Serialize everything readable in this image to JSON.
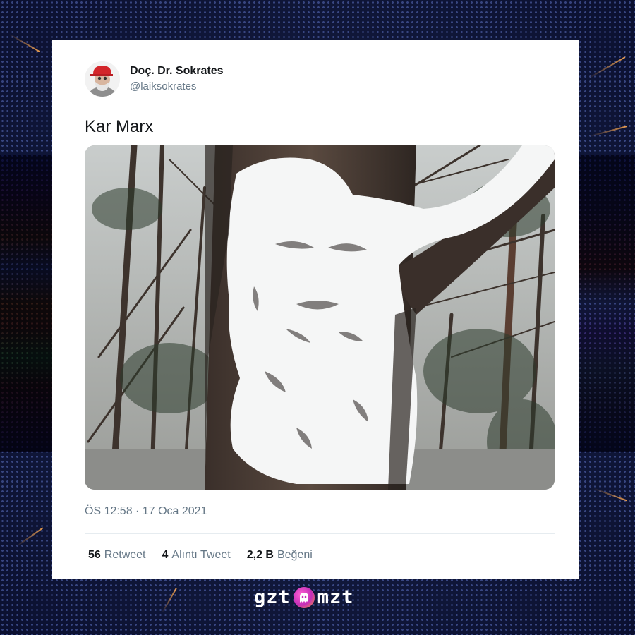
{
  "tweet": {
    "author": {
      "display_name": "Doç. Dr. Sokrates",
      "handle": "@laiksokrates",
      "avatar_icon": "avatar-man-red-cap"
    },
    "text": "Kar Marx",
    "media": {
      "kind": "photo",
      "subject": "snow-covered tree trunk shaped like a bearded face"
    },
    "timestamp": "ÖS 12:58 · 17 Oca 2021",
    "stats": [
      {
        "count": "56",
        "label": "Retweet"
      },
      {
        "count": "4",
        "label": "Alıntı Tweet"
      },
      {
        "count": "2,2 B",
        "label": "Beğeni"
      }
    ]
  },
  "branding": {
    "logo_left": "gzt",
    "logo_right": "mzt",
    "logo_icon": "ghost-icon",
    "accent_colors": [
      "#ff5fd2",
      "#ff9a2e"
    ]
  },
  "colors": {
    "background": "#121a3d",
    "card": "#ffffff",
    "primary_text": "#14171a",
    "secondary_text": "#657786"
  }
}
